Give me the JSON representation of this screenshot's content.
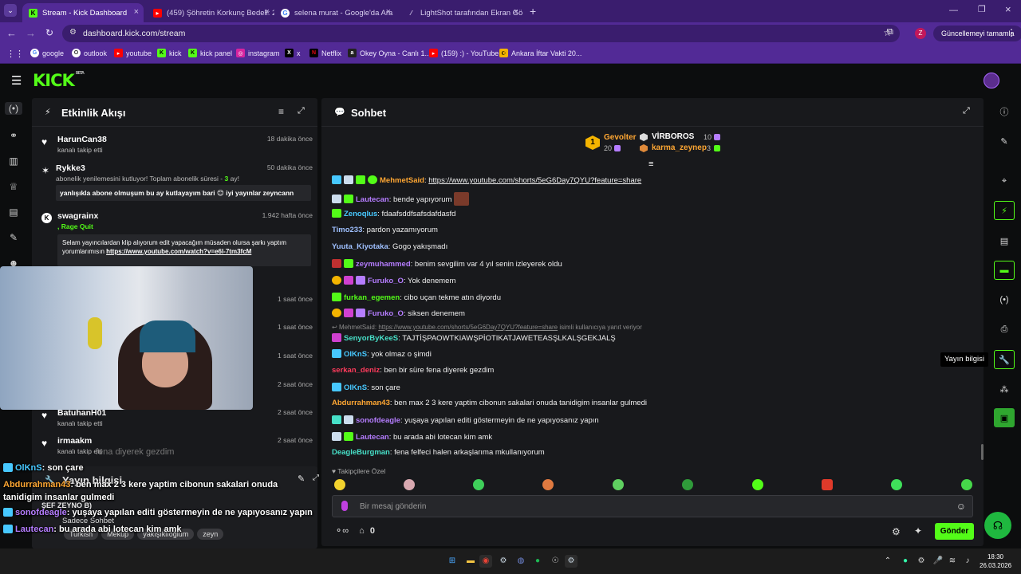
{
  "browser": {
    "tabs": [
      {
        "label": "Stream - Kick Dashboard",
        "active": true
      },
      {
        "label": "(459) Şöhretin Korkunç Bedeli: 2...",
        "active": false
      },
      {
        "label": "selena murat - Google'da Ara",
        "active": false
      },
      {
        "label": "LightShot tarafından Ekran Görün...",
        "active": false
      }
    ],
    "url": "dashboard.kick.com/stream",
    "update_label": "Güncellemeyi tamamla",
    "profile_initial": "Z",
    "bookmarks": [
      "google",
      "outlook",
      "youtube",
      "kick",
      "kick panel",
      "instagram",
      "x",
      "Netflix",
      "Okey Oyna - Canlı 1...",
      "(159) :) - YouTube",
      "Ankara İftar Vakti 20..."
    ]
  },
  "activity": {
    "title": "Etkinlik Akışı",
    "items": [
      {
        "name": "HarunCan38",
        "sub": "kanalı takip etti",
        "time": "18 dakika önce"
      },
      {
        "name": "Rykke3",
        "sub": "abonelik yenilemesini kutluyor! Toplam abonelik süresi - ",
        "months": "3",
        "sub_end": " ay!",
        "time": "50 dakika önce",
        "message": "yanlışıkla abone olmuşum bu ay kutlayayım bari 😊 iyi yayınlar zeyncann"
      },
      {
        "name": "swagrainx",
        "sub": ", Rage Quit",
        "time": "1.942 hafta önce",
        "message": "Selam yayıncılardan klip alıyorum edit yapacağım müsaden olursa şarkı yaptım yorumlarımısın ",
        "link": "https://www.youtube.com/watch?v=e6l-7tm3fcM"
      },
      {
        "name": "",
        "sub": "",
        "time": "1 saat önce"
      },
      {
        "name": "",
        "sub": "",
        "time": "1 saat önce"
      },
      {
        "name": "",
        "sub": "",
        "time": "1 saat önce"
      },
      {
        "name": "",
        "sub": "",
        "time": "2 saat önce"
      },
      {
        "name": "BatuhanH01",
        "sub": "kanalı takip etti",
        "time": "2 saat önce"
      },
      {
        "name": "irmaakm",
        "sub": "kanalı takip etti",
        "time": "2 saat önce"
      }
    ]
  },
  "stream_info": {
    "title": "Yayın bilgisi",
    "stream_title_frag": "ŞEF ZEYNO B)",
    "chat_mode": "Sadece Sohbet",
    "tags": [
      "Turkish",
      "Meküp",
      "yakışıklıoğlum",
      "zeyn"
    ]
  },
  "overlay_chat": [
    {
      "user": "OlKnS",
      "text": ": son çare",
      "color": "#47c8ff"
    },
    {
      "user": "Abdurrahman43",
      "text": ": ben max 2 3 kere yaptim cibonun sakalari onuda tanidigim insanlar gulmedi",
      "color": "#ffa733"
    },
    {
      "user": "sonofdeagle",
      "text": ": yuşaya yapılan editi göstermeyin de ne yapıyosanız yapın",
      "color": "#b57dff"
    },
    {
      "user": "Lautecan",
      "text": ": bu arada abi lotecan kim amk",
      "color": "#b57dff"
    }
  ],
  "overlay_ghost": "fena diyerek gezdim",
  "chat": {
    "title": "Sohbet",
    "leaders": [
      {
        "name": "Gevolter",
        "count": "20",
        "rank": "1",
        "color": "#ffa733"
      },
      {
        "name": "VİRBOROS",
        "count": "10",
        "color": "#ffffff"
      },
      {
        "name": "karma_zeynep",
        "count": "3",
        "color": "#ffa733"
      }
    ],
    "messages": [
      {
        "user": "MehmetSaid",
        "color": "#ffa733",
        "text": "",
        "link": "https://www.youtube.com/shorts/5eG6Day7QYU?feature=share"
      },
      {
        "user": "Lautecan",
        "color": "#b57dff",
        "text": "bende yapıyorum"
      },
      {
        "user": "Zenoqlus",
        "color": "#47c8ff",
        "text": "fdaafsddfsafsdafdasfd"
      },
      {
        "user": "Timo233",
        "color": "#9fc0ff",
        "text": "pardon yazamıyorum"
      },
      {
        "user": "Yuuta_Kiyotaka",
        "color": "#9fc0ff",
        "text": "Gogo yakışmadı"
      },
      {
        "user": "zeymuhammed",
        "color": "#b57dff",
        "text": "benim sevgilim var 4 yıl senin izleyerek oldu"
      },
      {
        "user": "Furuko_O",
        "color": "#b57dff",
        "text": "Yok denemem"
      },
      {
        "user": "furkan_egemen",
        "color": "#53fc18",
        "text": "cibo uçan tekme atın diyordu"
      },
      {
        "user": "Furuko_O",
        "color": "#b57dff",
        "text": "siksen denemem"
      },
      {
        "user": "SenyorByKeeS",
        "color": "#47e0c8",
        "text": "TAJTİŞPAOWTKIAWŞPİOTIKATJAWETEASŞLKALŞGEKJALŞ",
        "reply_to": "MehmetSaid:",
        "reply_link": "https://www.youtube.com/shorts/5eG6Day7QYU?feature=share",
        "reply_note": "isimli kullanıcıya yanıt veriyor"
      },
      {
        "user": "OlKnS",
        "color": "#47c8ff",
        "text": "yok olmaz o şimdi"
      },
      {
        "user": "serkan_deniz",
        "color": "#ff3b5c",
        "text": "ben bir süre fena diyerek gezdim"
      },
      {
        "user": "OlKnS",
        "color": "#47c8ff",
        "text": "son çare"
      },
      {
        "user": "Abdurrahman43",
        "color": "#ffa733",
        "text": "ben max 2 3 kere yaptim cibonun sakalari onuda tanidigim insanlar gulmedi"
      },
      {
        "user": "sonofdeagle",
        "color": "#b57dff",
        "text": "yuşaya yapılan editi göstermeyin de ne yapıyosanız yapın"
      },
      {
        "user": "Lautecan",
        "color": "#b57dff",
        "text": "bu arada abi lotecan kim amk"
      },
      {
        "user": "DeagleBurgman",
        "color": "#47e0c8",
        "text": "fena felfeci halen arkaşlarıma mkullanıyorum"
      }
    ],
    "followers_label": "Takipçilere Özel",
    "input_placeholder": "Bir mesaj gönderin",
    "points": "0",
    "send_label": "Gönder"
  },
  "tooltip": "Yayın bilgisi",
  "taskbar": {
    "time": "18:30",
    "date": "26.03.2026"
  }
}
